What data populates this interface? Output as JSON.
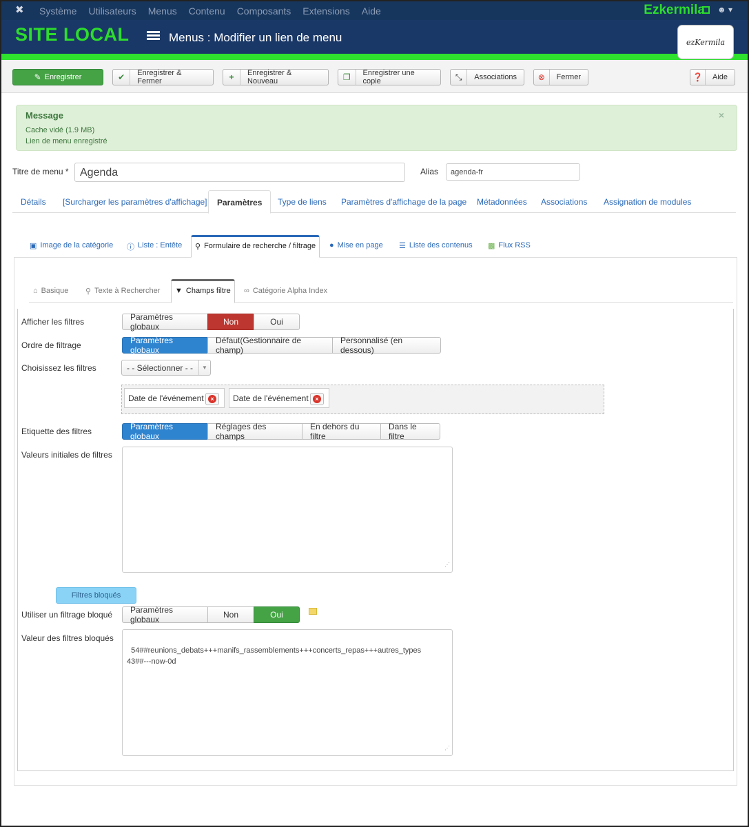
{
  "topbar": {
    "menu": [
      "Système",
      "Utilisateurs",
      "Menus",
      "Contenu",
      "Composants",
      "Extensions",
      "Aide"
    ],
    "site_name": "Ezkermila"
  },
  "header": {
    "brand": "SITE LOCAL",
    "title": "Menus : Modifier un lien de menu",
    "logo_text": "ezKermila"
  },
  "toolbar": {
    "save": "Enregistrer",
    "save_close": "Enregistrer & Fermer",
    "save_new": "Enregistrer & Nouveau",
    "save_copy": "Enregistrer une copie",
    "associations": "Associations",
    "close": "Fermer",
    "help": "Aide"
  },
  "message": {
    "heading": "Message",
    "line1": "Cache vidé (1.9 MB)",
    "line2": "Lien de menu enregistré",
    "close": "×"
  },
  "form": {
    "title_label": "Titre de menu *",
    "title_value": "Agenda",
    "alias_label": "Alias",
    "alias_value": "agenda-fr"
  },
  "tabs": [
    "Détails",
    "[Surcharger les paramètres d'affichage]",
    "Paramètres",
    "Type de liens",
    "Paramètres d'affichage de la page",
    "Métadonnées",
    "Associations",
    "Assignation de modules"
  ],
  "subtabs": [
    "Image de la catégorie",
    "Liste : Entête",
    "Formulaire de recherche / filtrage",
    "Mise en page",
    "Liste des contenus",
    "Flux RSS"
  ],
  "level3tabs": [
    "Basique",
    "Texte à Rechercher",
    "Champs filtre",
    "Catégorie Alpha Index"
  ],
  "fields": {
    "afficher": {
      "label": "Afficher les filtres",
      "options": [
        "Paramètres globaux",
        "Non",
        "Oui"
      ],
      "selected": "Non"
    },
    "ordre": {
      "label": "Ordre de filtrage",
      "options": [
        "Paramètres globaux",
        "Défaut(Gestionnaire de champ)",
        "Personnalisé (en dessous)"
      ],
      "selected": "Paramètres globaux"
    },
    "choisissez": {
      "label": "Choisissez les filtres",
      "select_value": "- - Sélectionner - -",
      "chips": [
        "Date de l'événement",
        "Date de l'événement"
      ]
    },
    "etiquette": {
      "label": "Etiquette des filtres",
      "options": [
        "Paramètres globaux",
        "Réglages des champs",
        "En dehors du filtre",
        "Dans le filtre"
      ],
      "selected": "Paramètres globaux"
    },
    "valeurs": {
      "label": "Valeurs initiales de filtres",
      "value": ""
    },
    "bloques_btn": "Filtres bloqués",
    "utiliser": {
      "label": "Utiliser un filtrage bloqué",
      "options": [
        "Paramètres globaux",
        "Non",
        "Oui"
      ],
      "selected": "Oui"
    },
    "valeur_bloques": {
      "label": "Valeur des filtres bloqués",
      "value": "54##reunions_debats+++manifs_rassemblements+++concerts_repas+++autres_types\n43##---now-0d"
    }
  },
  "colors": {
    "accent_green": "#2ddc2d",
    "header_blue": "#1a3867",
    "link_blue": "#2a69b8",
    "danger": "#bd362f",
    "primary": "#2f84d0",
    "success": "#45a245"
  }
}
